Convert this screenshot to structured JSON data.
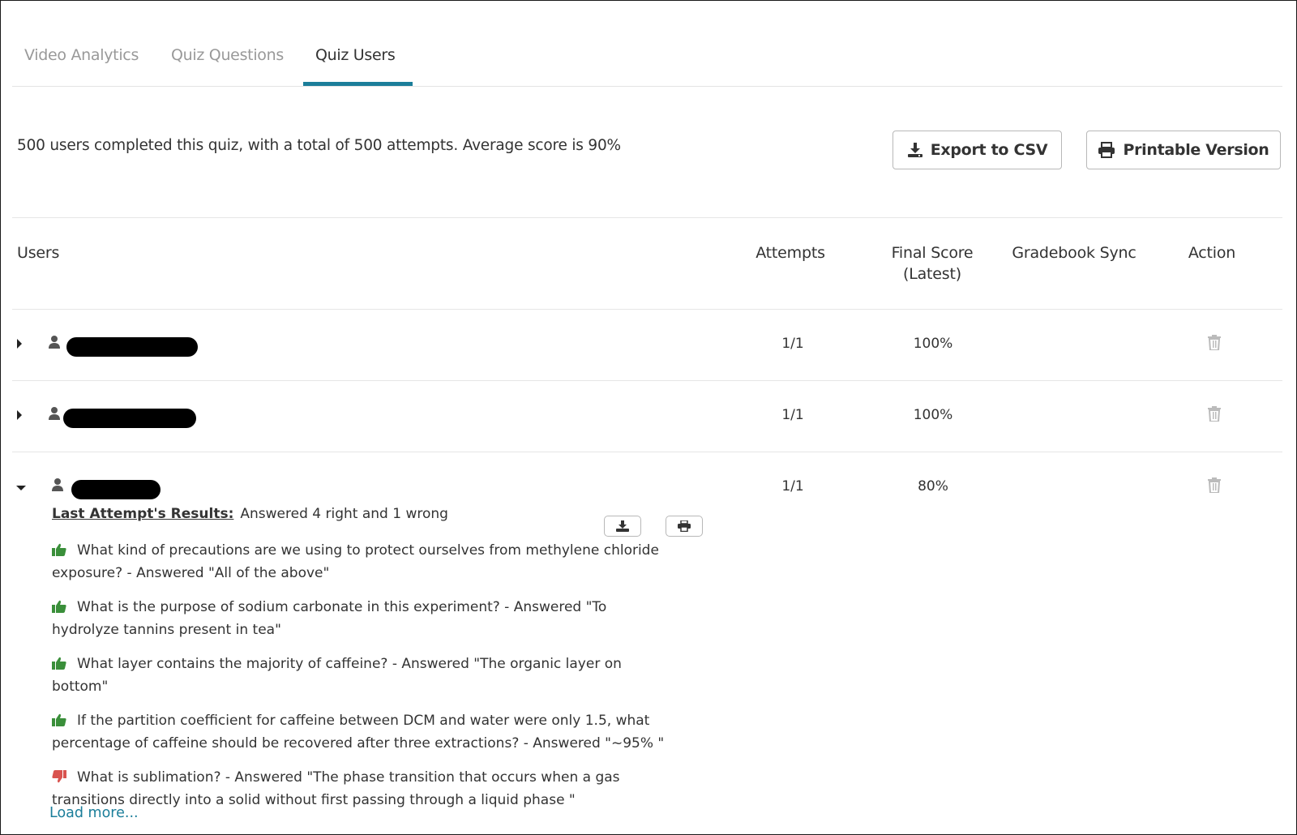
{
  "tabs": [
    {
      "label": "Video Analytics",
      "active": false
    },
    {
      "label": "Quiz Questions",
      "active": false
    },
    {
      "label": "Quiz Users",
      "active": true
    }
  ],
  "summary": "500 users completed this quiz, with a total of 500 attempts. Average score is 90%",
  "toolbar": {
    "export_label": "Export to CSV",
    "print_label": "Printable Version"
  },
  "table": {
    "headers": {
      "users": "Users",
      "attempts": "Attempts",
      "final_score_line1": "Final Score",
      "final_score_line2": "(Latest)",
      "gradebook_sync": "Gradebook Sync",
      "action": "Action"
    },
    "rows": [
      {
        "expanded": false,
        "attempts": "1/1",
        "final_score": "100%",
        "gradebook_sync": ""
      },
      {
        "expanded": false,
        "attempts": "1/1",
        "final_score": "100%",
        "gradebook_sync": ""
      },
      {
        "expanded": true,
        "attempts": "1/1",
        "final_score": "80%",
        "gradebook_sync": ""
      }
    ]
  },
  "details": {
    "label": "Last Attempt's Results:",
    "summary": "Answered 4 right and 1 wrong",
    "answers": [
      {
        "correct": true,
        "icon": "thumbs-up-icon",
        "text": "What kind of precautions are we using to protect ourselves from methylene chloride exposure? - Answered \"All of the above\""
      },
      {
        "correct": true,
        "icon": "thumbs-up-icon",
        "text": "What is the purpose of sodium carbonate in this experiment? - Answered \"To hydrolyze tannins present in tea\""
      },
      {
        "correct": true,
        "icon": "thumbs-up-icon",
        "text": "What layer contains the majority of caffeine? - Answered \"The organic layer on bottom\""
      },
      {
        "correct": true,
        "icon": "thumbs-up-icon",
        "text": "If the partition coefficient for caffeine between DCM and water were only 1.5, what percentage of caffeine should be recovered after three extractions? - Answered \"~95% \""
      },
      {
        "correct": false,
        "icon": "thumbs-down-icon",
        "text": "What is sublimation? - Answered \"The phase transition that occurs when a gas transitions directly into a solid without first passing through a liquid phase \""
      }
    ],
    "load_more": "Load more..."
  },
  "colors": {
    "accent": "#1b7e9a",
    "correct": "#3a8f3a",
    "wrong": "#d9534f"
  }
}
